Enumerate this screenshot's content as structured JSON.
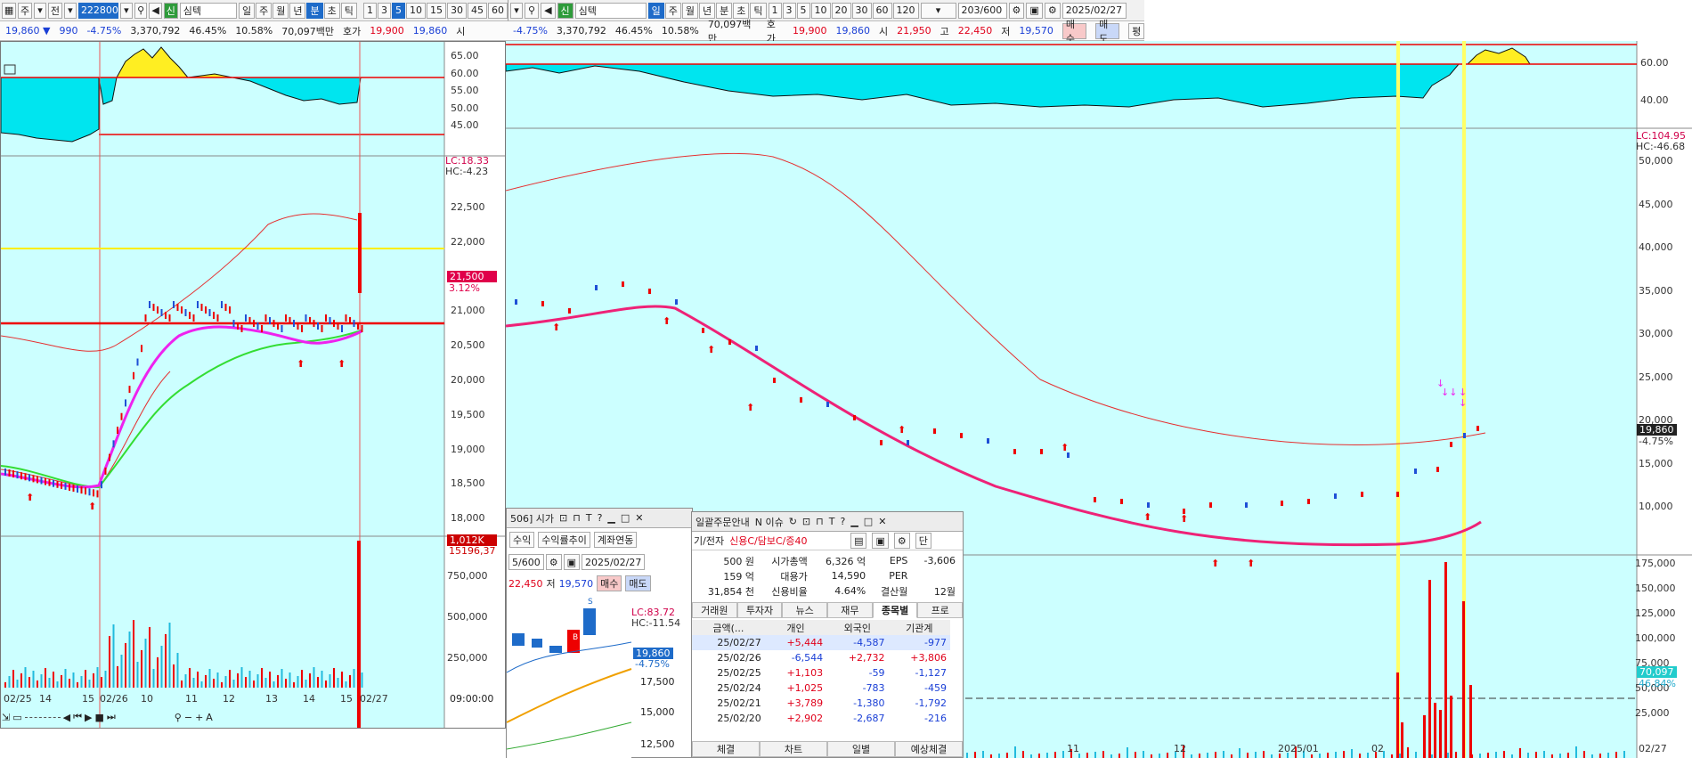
{
  "toolbar_left": {
    "type_label": "주",
    "jeon_label": "전",
    "code": "222800",
    "search_label": "심텍",
    "periods": [
      "일",
      "주",
      "월",
      "년",
      "분",
      "초",
      "틱"
    ],
    "active_period": "분",
    "minutes": [
      "1",
      "3",
      "5",
      "10",
      "15",
      "30",
      "45",
      "60"
    ],
    "active_minute": "5"
  },
  "toolbar_right": {
    "search_label": "심텍",
    "periods": [
      "일",
      "주",
      "월",
      "년",
      "분",
      "초",
      "틱"
    ],
    "active_period": "일",
    "minutes": [
      "1",
      "3",
      "5",
      "10",
      "20",
      "30",
      "60",
      "120"
    ],
    "count": "203/600",
    "date": "2025/02/27"
  },
  "quote_left": {
    "price": "19,860 ▼",
    "change": "990",
    "rate": "-4.75%",
    "volume": "3,370,792",
    "ratio": "46.45%",
    "turnover": "10.58%",
    "amount": "70,097백만",
    "ask_label": "호가",
    "ask": "19,900",
    "bid": "19,860",
    "open_label": "시"
  },
  "quote_right": {
    "rate": "-4.75%",
    "volume": "3,370,792",
    "ratio": "46.45%",
    "turnover": "10.58%",
    "amount": "70,097백만",
    "ask_label": "호가",
    "ask": "19,900",
    "bid": "19,860",
    "open_label": "시",
    "open": "21,950",
    "high_label": "고",
    "high": "22,450",
    "low_label": "저",
    "low": "19,570",
    "buy": "매수",
    "sell": "매도",
    "extra": "평"
  },
  "left_chart": {
    "osc_axis": [
      "65.00",
      "60.00",
      "55.00",
      "50.00",
      "45.00"
    ],
    "price_axis": [
      "22,500",
      "22,000",
      "21,500",
      "21,000",
      "20,500",
      "20,000",
      "19,500",
      "19,000",
      "18,500",
      "18,000"
    ],
    "vol_axis": [
      "750,000",
      "500,000",
      "250,000"
    ],
    "lc": "LC:18.33",
    "hc": "HC:-4.23",
    "price_tag": "21,500",
    "price_tag_rate": "3.12%",
    "vol_tag": "1,012K",
    "vol_tag2": "15196,37",
    "x_labels": [
      "02/25",
      "14",
      "15",
      "02/26",
      "10",
      "11",
      "12",
      "13",
      "14",
      "15",
      "02/27"
    ],
    "time": "09:00:00"
  },
  "right_chart": {
    "osc_axis": [
      "60.00",
      "40.00"
    ],
    "price_axis": [
      "50,000",
      "45,000",
      "40,000",
      "35,000",
      "30,000",
      "25,000",
      "20,000",
      "15,000",
      "10,000"
    ],
    "vol_axis": [
      "175,000",
      "150,000",
      "125,000",
      "100,000",
      "75,000",
      "50,000",
      "25,000"
    ],
    "lc": "LC:104.95",
    "hc": "HC:-46.68",
    "price_tag": "19,860",
    "price_tag_rate": "-4.75%",
    "vol_tag": "70,097",
    "vol_tag_rate": "46.84%",
    "x_labels": [
      "11",
      "12",
      "2025/01",
      "02",
      "02/27"
    ]
  },
  "mini_window": {
    "title": "506] 시가",
    "tabs": [
      "수익",
      "수익률추이",
      "계좌연동"
    ],
    "count": "5/600",
    "date": "2025/02/27",
    "high": "22,450",
    "low_label": "저",
    "low": "19,570",
    "buy": "매수",
    "sell": "매도",
    "lc": "LC:83.72",
    "hc": "HC:-11.54",
    "price_tag": "19,860",
    "price_rate": "-4.75%",
    "axis": [
      "17,500",
      "15,000",
      "12,500"
    ]
  },
  "info_window": {
    "title": "일괄주문안내",
    "news": "N 이슈",
    "sector": "기/전자",
    "credit": "신용C/담보C/증40",
    "rows": [
      [
        "500 원",
        "시가총액",
        "6,326 억",
        "EPS",
        "-3,606"
      ],
      [
        "159 억",
        "대용가",
        "14,590",
        "PER",
        ""
      ],
      [
        "31,854 천",
        "신용비율",
        "4.64%",
        "결산월",
        "12월"
      ]
    ],
    "tabs": [
      "거래원",
      "투자자",
      "뉴스",
      "재무",
      "종목별",
      "프로"
    ],
    "active_tab": "종목별",
    "table_headers": [
      "금액(...",
      "개인",
      "외국인",
      "기관계"
    ],
    "table_rows": [
      [
        "25/02/27",
        "+5,444",
        "-4,587",
        "-977"
      ],
      [
        "25/02/26",
        "-6,544",
        "+2,732",
        "+3,806"
      ],
      [
        "25/02/25",
        "+1,103",
        "-59",
        "-1,127"
      ],
      [
        "25/02/24",
        "+1,025",
        "-783",
        "-459"
      ],
      [
        "25/02/21",
        "+3,789",
        "-1,380",
        "-1,792"
      ],
      [
        "25/02/20",
        "+2,902",
        "-2,687",
        "-216"
      ]
    ],
    "bottom_tabs": [
      "체결",
      "차트",
      "일별",
      "예상체결"
    ]
  }
}
